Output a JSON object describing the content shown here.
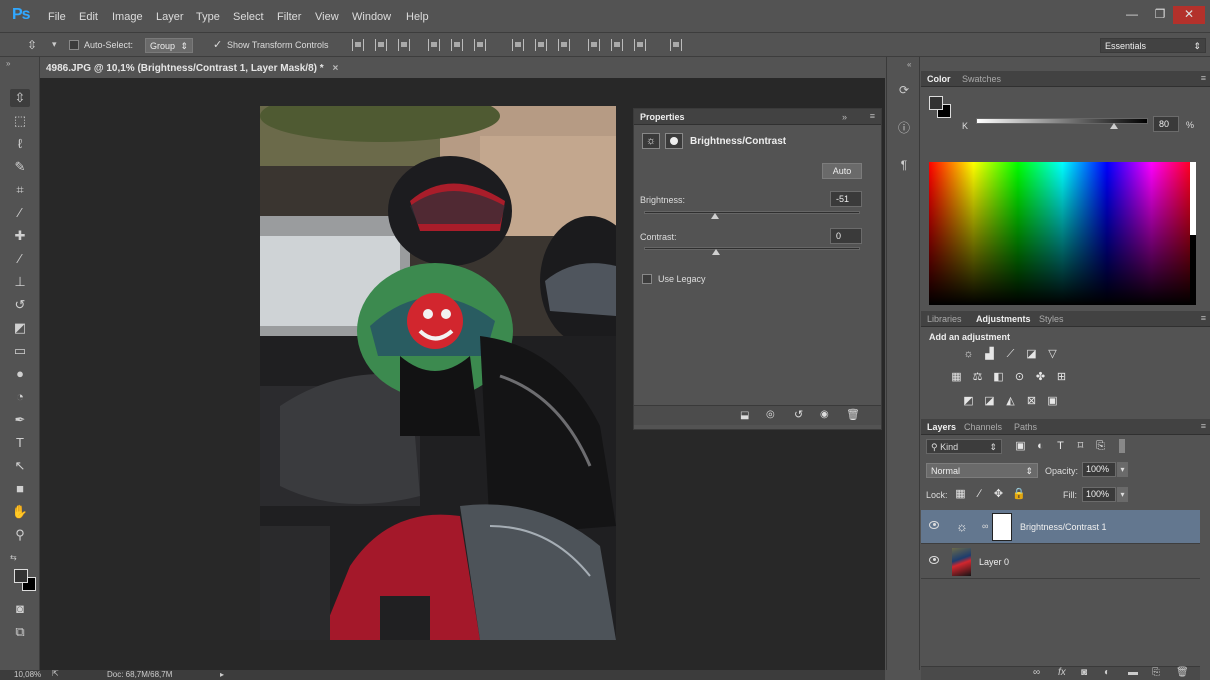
{
  "app": {
    "logo": "Ps"
  },
  "menu": [
    "File",
    "Edit",
    "Image",
    "Layer",
    "Type",
    "Select",
    "Filter",
    "View",
    "Window",
    "Help"
  ],
  "window_controls": {
    "minimize": "—",
    "restore": "❐",
    "close": "✕"
  },
  "options_bar": {
    "auto_select_label": "Auto-Select:",
    "auto_select_value": "Group",
    "show_transform_label": "Show Transform Controls",
    "workspace": "Essentials"
  },
  "document_tab": {
    "title": "4986.JPG @ 10,1% (Brightness/Contrast 1, Layer Mask/8) *",
    "close": "×"
  },
  "status": {
    "zoom": "10,08%",
    "doc": "Doc: 68,7M/68,7M"
  },
  "properties": {
    "title": "Properties",
    "type": "Brightness/Contrast",
    "auto_label": "Auto",
    "brightness_label": "Brightness:",
    "brightness_value": "-51",
    "brightness_level": -51,
    "contrast_label": "Contrast:",
    "contrast_value": "0",
    "contrast_level": 0,
    "legacy_label": "Use Legacy"
  },
  "color_panel": {
    "tabs": [
      "Color",
      "Swatches"
    ],
    "channel_label": "K",
    "k_value": "80",
    "k_unit": "%",
    "k_level": 80
  },
  "adjustments_panel": {
    "tabs": [
      "Libraries",
      "Adjustments",
      "Styles"
    ],
    "heading": "Add an adjustment"
  },
  "layers_panel": {
    "tabs": [
      "Layers",
      "Channels",
      "Paths"
    ],
    "filter_kind": "Kind",
    "blend_mode": "Normal",
    "opacity_label": "Opacity:",
    "opacity_value": "100%",
    "lock_label": "Lock:",
    "fill_label": "Fill:",
    "fill_value": "100%",
    "layers": [
      {
        "name": "Brightness/Contrast 1",
        "selected": true
      },
      {
        "name": "Layer 0",
        "selected": false
      }
    ]
  },
  "colors": {
    "accent_blue": "#31a8ff",
    "selected_layer": "#63778f",
    "canvas_bg": "#282828"
  }
}
